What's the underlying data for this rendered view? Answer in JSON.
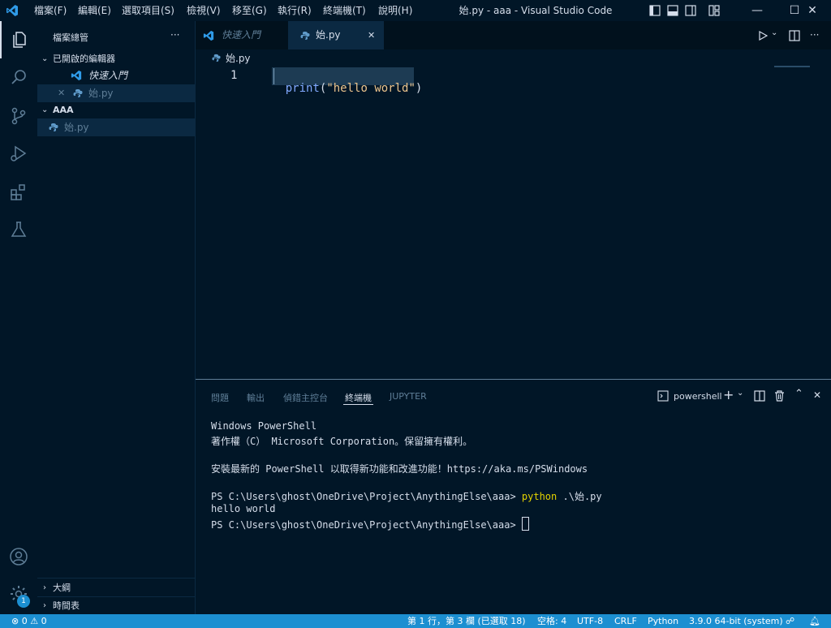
{
  "window": {
    "title": "始.py - aaa - Visual Studio Code",
    "menu": [
      "檔案(F)",
      "編輯(E)",
      "選取項目(S)",
      "檢視(V)",
      "移至(G)",
      "執行(R)",
      "終端機(T)",
      "說明(H)"
    ],
    "min_label": "—",
    "max_label": "☐",
    "close_label": "✕"
  },
  "sidebar": {
    "header": "檔案總管",
    "more": "···",
    "open_editors": {
      "title": "已開啟的編輯器",
      "items": [
        {
          "label": "快速入門"
        },
        {
          "label": "始.py"
        }
      ]
    },
    "folder": {
      "title": "AAA",
      "files": [
        {
          "label": "始.py"
        }
      ]
    },
    "outline": "大綱",
    "timeline": "時間表"
  },
  "tabs": [
    {
      "label": "快速入門"
    },
    {
      "label": "始.py"
    }
  ],
  "breadcrumb": "始.py",
  "editor": {
    "line_number": "1",
    "code_func": "print",
    "code_open": "(",
    "code_string": "\"hello world\"",
    "code_close": ")"
  },
  "panel": {
    "tabs": [
      "問題",
      "輸出",
      "偵錯主控台",
      "終端機",
      "JUPYTER"
    ],
    "active_tab": "終端機",
    "shell": "powershell",
    "terminal": {
      "line1": "Windows PowerShell",
      "line2": "著作權（C） Microsoft Corporation。保留擁有權利。",
      "line3": "安裝最新的 PowerShell 以取得新功能和改進功能！https://aka.ms/PSWindows",
      "prompt1": "PS C:\\Users\\ghost\\OneDrive\\Project\\AnythingElse\\aaa> ",
      "cmd": "python",
      "cmd_arg": " .\\始.py",
      "output": "hello world",
      "prompt2": "PS C:\\Users\\ghost\\OneDrive\\Project\\AnythingElse\\aaa> "
    }
  },
  "status": {
    "errors": "0",
    "warnings": "0",
    "cursor": "第 1 行，第 3 欄 (已選取 18)",
    "spaces": "空格: 4",
    "encoding": "UTF-8",
    "eol": "CRLF",
    "language": "Python",
    "interpreter": "3.9.0 64-bit (system)",
    "settings_badge": "1"
  },
  "colors": {
    "background": "#011627",
    "accent": "#1c8fd1",
    "string": "#ecc48d",
    "function": "#82aaff",
    "command": "#e3d200"
  }
}
